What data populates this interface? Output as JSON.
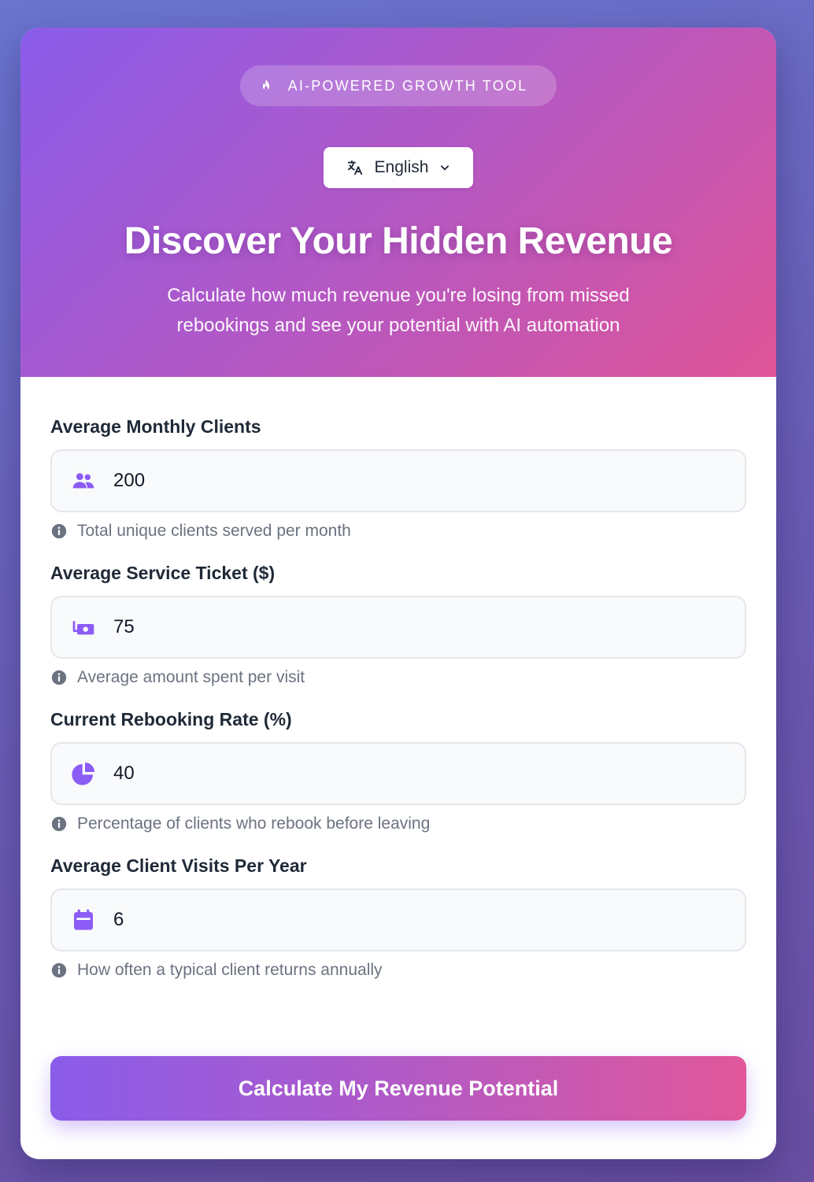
{
  "header": {
    "badge_icon": "flame-icon",
    "badge_text": "AI-POWERED GROWTH TOOL",
    "language": {
      "icon": "translate-icon",
      "selected": "English"
    },
    "title": "Discover Your Hidden Revenue",
    "subtitle": "Calculate how much revenue you're losing from missed rebookings and see your potential with AI automation"
  },
  "fields": [
    {
      "label": "Average Monthly Clients",
      "icon": "users-icon",
      "value": "200",
      "hint": "Total unique clients served per month"
    },
    {
      "label": "Average Service Ticket ($)",
      "icon": "money-icon",
      "value": "75",
      "hint": "Average amount spent per visit"
    },
    {
      "label": "Current Rebooking Rate (%)",
      "icon": "pie-chart-icon",
      "value": "40",
      "hint": "Percentage of clients who rebook before leaving"
    },
    {
      "label": "Average Client Visits Per Year",
      "icon": "calendar-icon",
      "value": "6",
      "hint": "How often a typical client returns annually"
    }
  ],
  "submit_label": "Calculate My Revenue Potential",
  "colors": {
    "accent": "#8b5cf6",
    "gradient_start": "#8a5cea",
    "gradient_end": "#df5497"
  }
}
